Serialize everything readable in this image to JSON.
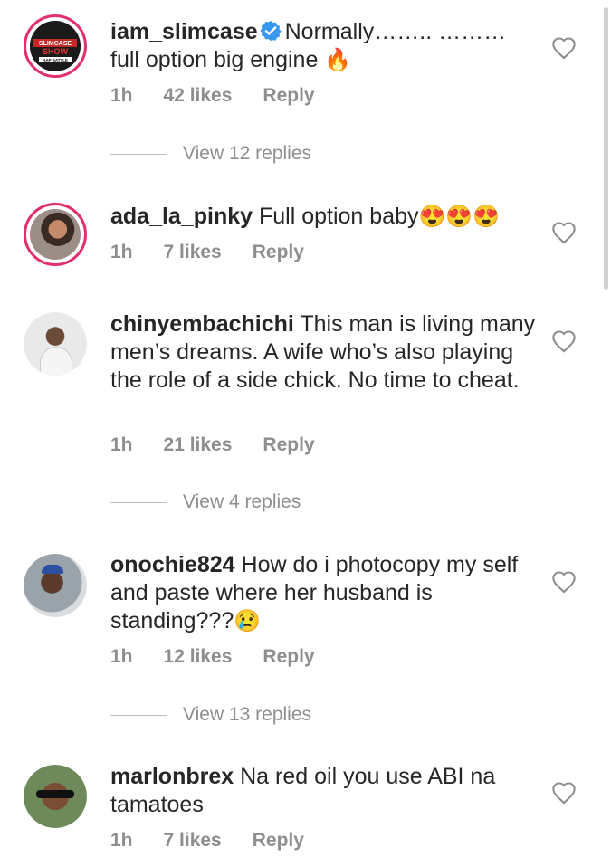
{
  "comments": [
    {
      "username": "iam_slimcase",
      "verified": true,
      "text": "Normally…….. ……… full option big engine",
      "emoji": "🔥",
      "time": "1h",
      "likes": "42 likes",
      "reply": "Reply",
      "view_replies": "View 12 replies",
      "avatar": {
        "kind": "logo",
        "logo_text_1": "SLIMCASE",
        "logo_text_2": "SHOW",
        "logo_text_3": "RAP BATTLE"
      }
    },
    {
      "username": "ada_la_pinky",
      "verified": false,
      "text": "Full option baby",
      "emoji": "😍😍😍",
      "time": "1h",
      "likes": "7 likes",
      "reply": "Reply",
      "view_replies": ""
    },
    {
      "username": "chinyembachichi",
      "verified": false,
      "text": "This man is living many men’s dreams. A wife who’s also playing the role of a side chick. No time to cheat.",
      "emoji": "",
      "time": "1h",
      "likes": "21 likes",
      "reply": "Reply",
      "view_replies": "View 4 replies"
    },
    {
      "username": "onochie824",
      "verified": false,
      "text": "How do i photocopy my self and paste where her husband is standing???",
      "emoji": "😢",
      "time": "1h",
      "likes": "12 likes",
      "reply": "Reply",
      "view_replies": "View 13 replies"
    },
    {
      "username": "marlonbrex",
      "verified": false,
      "text": "Na red oil you use ABI na tamatoes",
      "emoji": "",
      "time": "1h",
      "likes": "7 likes",
      "reply": "Reply",
      "view_replies": ""
    }
  ],
  "colors": {
    "text": "#262626",
    "meta": "#8e8e8e",
    "verified": "#3897f0",
    "story_ring": "#e1306c"
  },
  "icons": {
    "like": "heart-outline-icon",
    "verified": "verified-badge-icon"
  }
}
